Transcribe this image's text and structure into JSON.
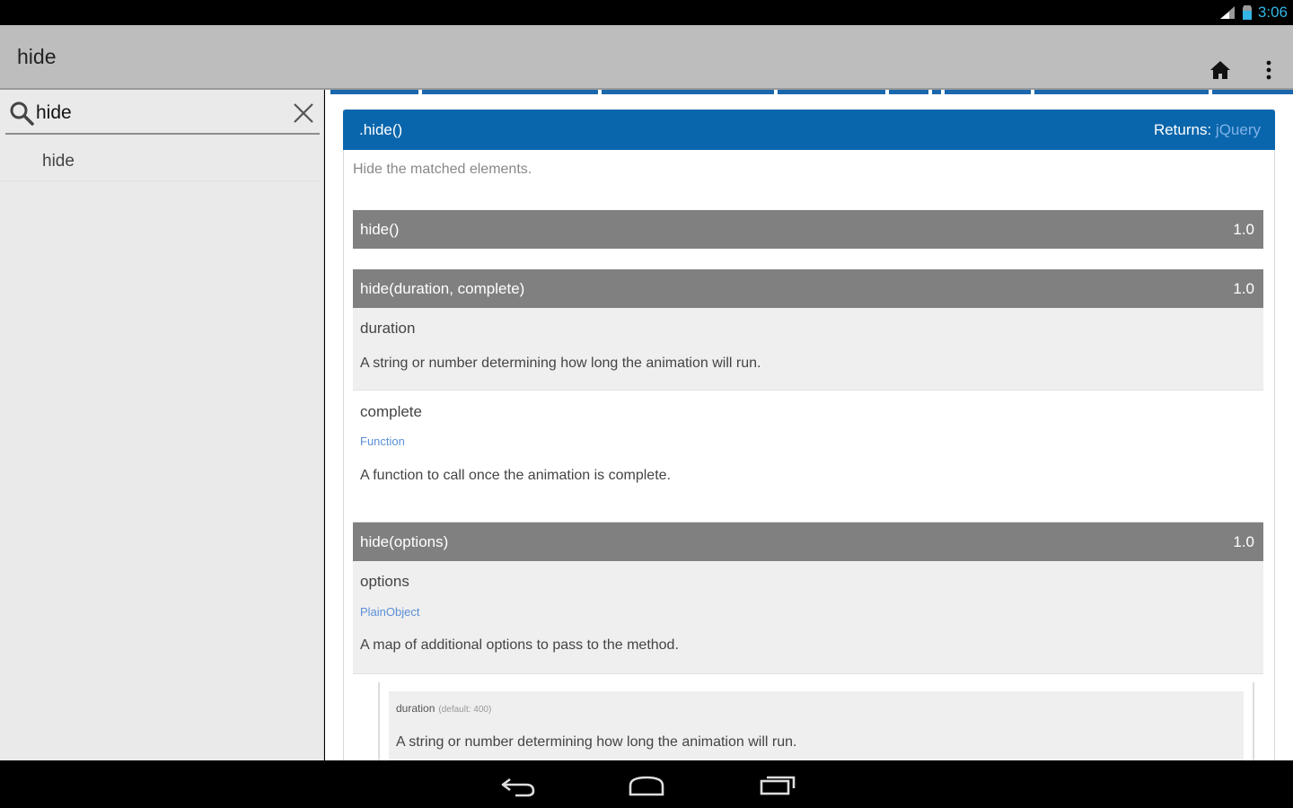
{
  "status": {
    "time": "3:06"
  },
  "actionbar": {
    "title": "hide",
    "home_icon": "home-icon",
    "overflow_icon": "more-vert-icon"
  },
  "search": {
    "value": "hide",
    "placeholder": ""
  },
  "results": [
    {
      "label": "hide"
    }
  ],
  "entry": {
    "name": ".hide()",
    "returns_label": "Returns:",
    "returns_type": "jQuery",
    "description": "Hide the matched elements.",
    "signatures": [
      {
        "name": "hide()",
        "version": "1.0"
      },
      {
        "name": "hide(duration, complete)",
        "version": "1.0"
      },
      {
        "name": "hide(options)",
        "version": "1.0"
      }
    ],
    "args": {
      "duration": {
        "name": "duration",
        "desc": "A string or number determining how long the animation will run."
      },
      "complete": {
        "name": "complete",
        "type": "Function",
        "desc": "A function to call once the animation is complete."
      },
      "options": {
        "name": "options",
        "type": "PlainObject",
        "desc": "A map of additional options to pass to the method."
      }
    },
    "nested": {
      "name": "duration",
      "default": "(default: 400)",
      "desc": "A string or number determining how long the animation will run."
    }
  },
  "colors": {
    "accent": "#0a66ac",
    "signature_bar": "#808080",
    "type_link": "#5b8fd6",
    "status_time": "#33b5e5"
  }
}
